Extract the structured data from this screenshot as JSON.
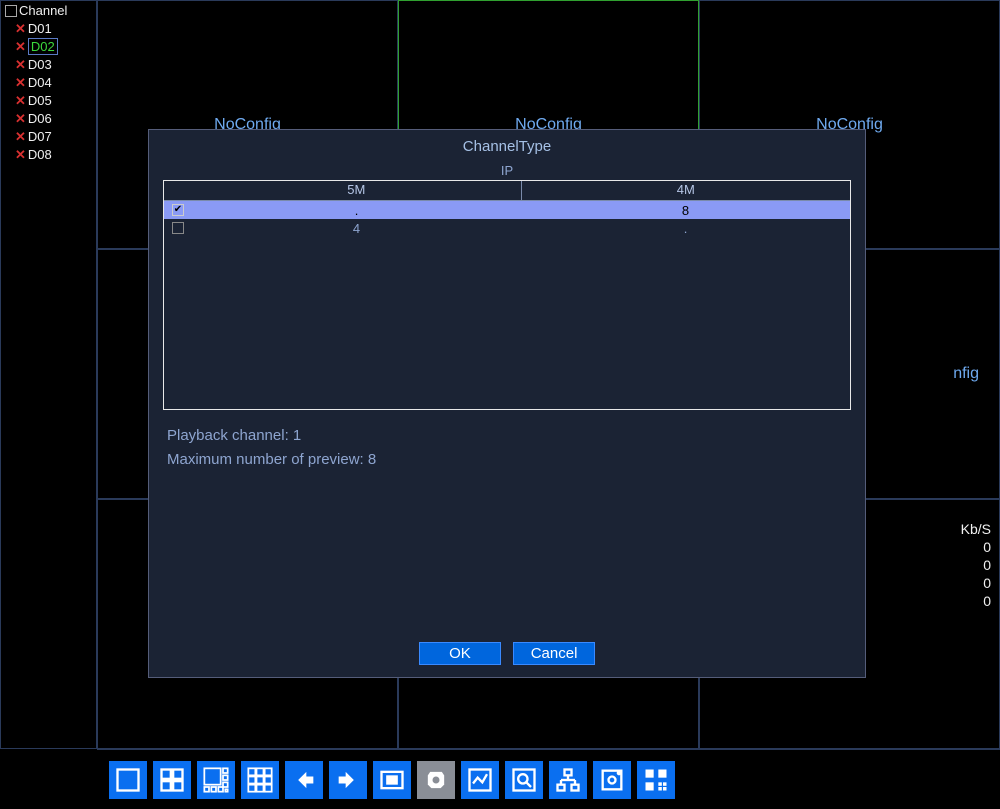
{
  "sidebar": {
    "title": "Channel",
    "items": [
      {
        "label": "D01",
        "selected": false
      },
      {
        "label": "D02",
        "selected": true
      },
      {
        "label": "D03",
        "selected": false
      },
      {
        "label": "D04",
        "selected": false
      },
      {
        "label": "D05",
        "selected": false
      },
      {
        "label": "D06",
        "selected": false
      },
      {
        "label": "D07",
        "selected": false
      },
      {
        "label": "D08",
        "selected": false
      }
    ]
  },
  "grid": {
    "noconfig": "NoConfig",
    "stats_label": "Kb/S",
    "stats_values": [
      "0",
      "0",
      "0",
      "0"
    ]
  },
  "modal": {
    "title": "ChannelType",
    "group_label": "IP",
    "columns": [
      "5M",
      "4M"
    ],
    "rows": [
      {
        "checked": true,
        "col1": ".",
        "col2": "8"
      },
      {
        "checked": false,
        "col1": "4",
        "col2": "."
      }
    ],
    "playback_label": "Playback channel: 1",
    "preview_label": "Maximum number of preview: 8",
    "ok": "OK",
    "cancel": "Cancel"
  },
  "toolbar": {
    "buttons": [
      {
        "name": "layout-1-button"
      },
      {
        "name": "layout-4-button"
      },
      {
        "name": "layout-8-button"
      },
      {
        "name": "layout-9-button"
      },
      {
        "name": "prev-button"
      },
      {
        "name": "next-button"
      },
      {
        "name": "fullscreen-button"
      },
      {
        "name": "ptz-button"
      },
      {
        "name": "chart-button"
      },
      {
        "name": "search-button"
      },
      {
        "name": "network-button"
      },
      {
        "name": "storage-button"
      },
      {
        "name": "qr-button"
      }
    ]
  }
}
